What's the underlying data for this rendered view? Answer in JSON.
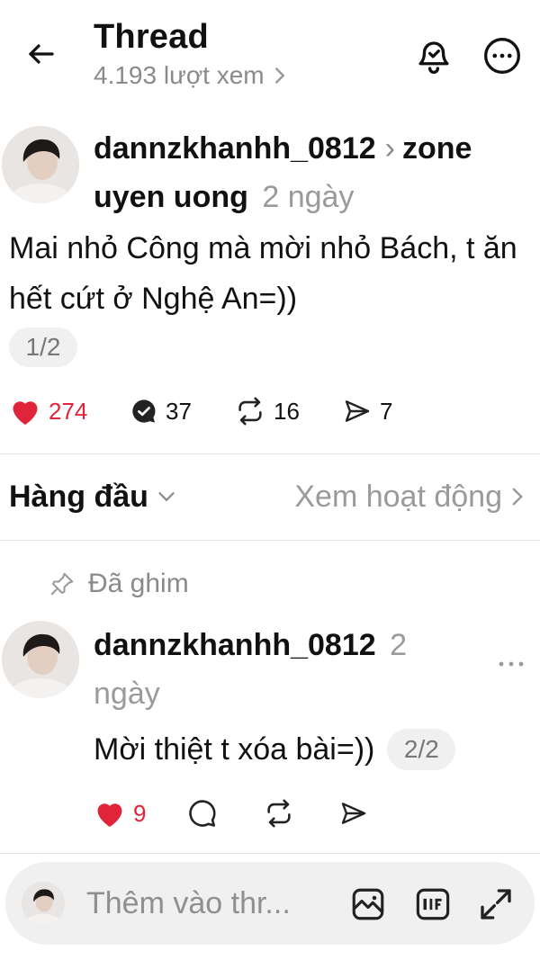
{
  "header": {
    "title": "Thread",
    "views": "4.193 lượt xem"
  },
  "post": {
    "username": "dannzkhanhh_0812",
    "community": "zone uyen uong",
    "time": "2 ngày",
    "text": "Mai nhỏ Công mà mời nhỏ Bách, t ăn hết cứt ở Nghệ An=))",
    "page": "1/2",
    "likes": "274",
    "replies": "37",
    "reposts": "16",
    "shares": "7",
    "liked": true
  },
  "sort": {
    "label": "Hàng đầu",
    "activity": "Xem hoạt động"
  },
  "reply": {
    "pinned_label": "Đã ghim",
    "username": "dannzkhanhh_0812",
    "time": "2 ngày",
    "text": "Mời thiệt t xóa bài=))",
    "page": "2/2",
    "likes": "9",
    "liked": true
  },
  "composer": {
    "placeholder": "Thêm vào thr..."
  },
  "colors": {
    "like_red": "#e0243a",
    "muted": "#8a8a8a",
    "pill_bg": "#f0f0f0"
  },
  "icons": [
    "arrow-left-icon",
    "chevron-right-icon",
    "bell-icon",
    "more-icon",
    "heart-icon",
    "comment-icon",
    "repost-icon",
    "share-icon",
    "chevron-down-icon",
    "pin-icon",
    "image-icon",
    "gif-icon",
    "expand-icon"
  ]
}
